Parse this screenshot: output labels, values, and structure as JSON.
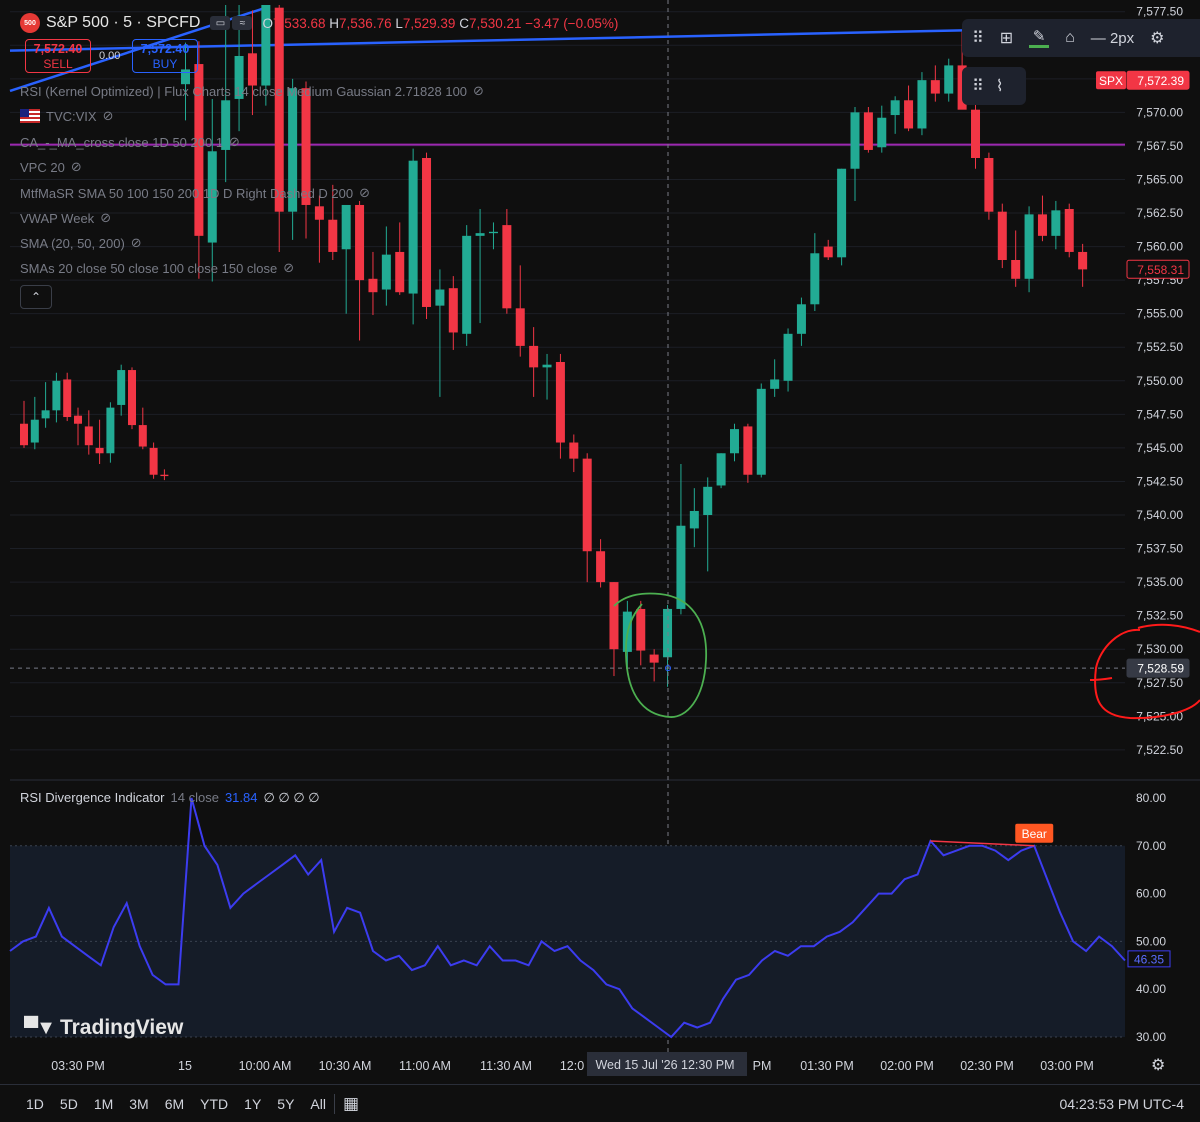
{
  "header": {
    "exchange_badge": "500",
    "symbol": "S&P 500 · 5 · SPCFD",
    "open_label": "O",
    "open": "7,533.68",
    "high_label": "H",
    "high": "7,536.76",
    "low_label": "L",
    "low": "7,529.39",
    "close_label": "C",
    "close": "7,530.21",
    "change": "−3.47 (−0.05%)"
  },
  "trade": {
    "sell_price": "7,572.40",
    "sell_label": "SELL",
    "spread": "0.00",
    "buy_price": "7,572.40",
    "buy_label": "BUY"
  },
  "indicators": [
    "RSI (Kernel Optimized) | Flux Charts 14 close Medium Gaussian 2.71828 100",
    "TVC:VIX",
    "CA_-_MA_cross close 1D 50 200 1",
    "VPC 20",
    "MtfMaSR SMA 50 100 150 200 1D D Right Dashed D 200",
    "VWAP Week",
    "SMA (20, 50, 200)",
    "SMAs 20 close 50 close 100 close 150 close"
  ],
  "toolbar": {
    "width_label": "2px"
  },
  "colors": {
    "up": "#22ab94",
    "down": "#f23645",
    "trendline": "#2962ff",
    "sr_line": "#9c27b0",
    "rsi_line": "#3c3cf0",
    "annotation_green": "#4caf50",
    "annotation_red": "#ff1a1a"
  },
  "chart_data": [
    {
      "type": "candlestick",
      "title": "S&P 500 · 5 · SPCFD",
      "price_axis": {
        "ylim": [
          7521.0,
          7578.0
        ],
        "ticks": [
          "7,577.50",
          "7,575.00",
          "7,572.50",
          "7,570.00",
          "7,567.50",
          "7,565.00",
          "7,562.50",
          "7,560.00",
          "7,557.50",
          "7,555.00",
          "7,552.50",
          "7,550.00",
          "7,547.50",
          "7,545.00",
          "7,542.50",
          "7,540.00",
          "7,537.50",
          "7,535.00",
          "7,532.50",
          "7,530.00",
          "7,527.50",
          "7,525.00",
          "7,522.50"
        ]
      },
      "time_axis": {
        "ticks": [
          "03:30 PM",
          "15",
          "10:00 AM",
          "10:30 AM",
          "11:00 AM",
          "11:30 AM",
          "12:0",
          "Wed 15 Jul '26   12:30 PM",
          "PM",
          "01:30 PM",
          "02:00 PM",
          "02:30 PM",
          "03:00 PM"
        ]
      },
      "price_labels": [
        {
          "tag": "SPX",
          "value": "7,572.39"
        },
        {
          "value": "7,558.31"
        },
        {
          "value": "7,528.59"
        }
      ],
      "previous_session_candles": [
        {
          "o": 7546.8,
          "h": 7548.5,
          "l": 7545.0,
          "c": 7545.2
        },
        {
          "o": 7545.4,
          "h": 7548.8,
          "l": 7544.9,
          "c": 7547.1
        },
        {
          "o": 7547.2,
          "h": 7549.9,
          "l": 7546.5,
          "c": 7547.8
        },
        {
          "o": 7547.8,
          "h": 7550.6,
          "l": 7546.9,
          "c": 7550.0
        },
        {
          "o": 7550.1,
          "h": 7550.6,
          "l": 7547.0,
          "c": 7547.3
        },
        {
          "o": 7547.4,
          "h": 7548.0,
          "l": 7545.2,
          "c": 7546.8
        },
        {
          "o": 7546.6,
          "h": 7547.8,
          "l": 7544.5,
          "c": 7545.2
        },
        {
          "o": 7545.0,
          "h": 7547.1,
          "l": 7543.8,
          "c": 7544.6
        },
        {
          "o": 7544.6,
          "h": 7548.4,
          "l": 7543.9,
          "c": 7548.0
        },
        {
          "o": 7548.2,
          "h": 7551.2,
          "l": 7547.4,
          "c": 7550.8
        },
        {
          "o": 7550.8,
          "h": 7551.0,
          "l": 7546.4,
          "c": 7546.7
        },
        {
          "o": 7546.7,
          "h": 7548.0,
          "l": 7544.9,
          "c": 7545.1
        },
        {
          "o": 7545.0,
          "h": 7545.4,
          "l": 7542.7,
          "c": 7543.0
        },
        {
          "o": 7543.0,
          "h": 7543.4,
          "l": 7542.6,
          "c": 7542.9
        }
      ],
      "candles": [
        {
          "o": 7572.1,
          "h": 7575.2,
          "l": 7569.4,
          "c": 7573.2
        },
        {
          "o": 7573.6,
          "h": 7575.3,
          "l": 7557.6,
          "c": 7560.8
        },
        {
          "o": 7560.3,
          "h": 7571.0,
          "l": 7557.4,
          "c": 7567.1
        },
        {
          "o": 7567.2,
          "h": 7578.0,
          "l": 7564.8,
          "c": 7570.9
        },
        {
          "o": 7571.0,
          "h": 7578.0,
          "l": 7568.6,
          "c": 7574.2
        },
        {
          "o": 7574.4,
          "h": 7577.6,
          "l": 7569.8,
          "c": 7572.0
        },
        {
          "o": 7572.0,
          "h": 7578.0,
          "l": 7570.5,
          "c": 7578.0
        },
        {
          "o": 7577.8,
          "h": 7578.0,
          "l": 7559.6,
          "c": 7562.6
        },
        {
          "o": 7562.6,
          "h": 7572.5,
          "l": 7560.5,
          "c": 7571.8
        },
        {
          "o": 7571.8,
          "h": 7572.3,
          "l": 7560.6,
          "c": 7563.1
        },
        {
          "o": 7563.0,
          "h": 7563.8,
          "l": 7558.8,
          "c": 7562.0
        },
        {
          "o": 7562.0,
          "h": 7564.6,
          "l": 7559.0,
          "c": 7559.6
        },
        {
          "o": 7559.8,
          "h": 7563.0,
          "l": 7555.0,
          "c": 7563.1
        },
        {
          "o": 7563.1,
          "h": 7563.4,
          "l": 7553.0,
          "c": 7557.5
        },
        {
          "o": 7557.6,
          "h": 7559.6,
          "l": 7554.9,
          "c": 7556.6
        },
        {
          "o": 7556.8,
          "h": 7561.5,
          "l": 7555.6,
          "c": 7559.4
        },
        {
          "o": 7559.6,
          "h": 7561.8,
          "l": 7556.4,
          "c": 7556.6
        },
        {
          "o": 7556.5,
          "h": 7567.3,
          "l": 7554.2,
          "c": 7566.4
        },
        {
          "o": 7566.6,
          "h": 7567.0,
          "l": 7554.6,
          "c": 7555.5
        },
        {
          "o": 7555.6,
          "h": 7558.3,
          "l": 7548.8,
          "c": 7556.8
        },
        {
          "o": 7556.9,
          "h": 7557.8,
          "l": 7552.3,
          "c": 7553.6
        },
        {
          "o": 7553.5,
          "h": 7561.6,
          "l": 7552.6,
          "c": 7560.8
        },
        {
          "o": 7560.8,
          "h": 7562.8,
          "l": 7554.3,
          "c": 7561.0
        },
        {
          "o": 7561.0,
          "h": 7561.8,
          "l": 7559.8,
          "c": 7561.1
        },
        {
          "o": 7561.6,
          "h": 7562.8,
          "l": 7555.0,
          "c": 7555.4
        },
        {
          "o": 7555.4,
          "h": 7558.6,
          "l": 7551.8,
          "c": 7552.6
        },
        {
          "o": 7552.6,
          "h": 7554.0,
          "l": 7548.8,
          "c": 7551.0
        },
        {
          "o": 7551.0,
          "h": 7552.0,
          "l": 7548.6,
          "c": 7551.2
        },
        {
          "o": 7551.4,
          "h": 7552.0,
          "l": 7544.2,
          "c": 7545.4
        },
        {
          "o": 7545.4,
          "h": 7546.0,
          "l": 7543.2,
          "c": 7544.2
        },
        {
          "o": 7544.2,
          "h": 7544.6,
          "l": 7535.0,
          "c": 7537.3
        },
        {
          "o": 7537.3,
          "h": 7538.2,
          "l": 7534.6,
          "c": 7535.0
        },
        {
          "o": 7535.0,
          "h": 7535.0,
          "l": 7528.0,
          "c": 7530.0
        },
        {
          "o": 7529.8,
          "h": 7533.6,
          "l": 7528.5,
          "c": 7532.8
        },
        {
          "o": 7533.0,
          "h": 7533.6,
          "l": 7528.8,
          "c": 7529.9
        },
        {
          "o": 7529.6,
          "h": 7530.0,
          "l": 7527.6,
          "c": 7529.0
        },
        {
          "o": 7529.4,
          "h": 7533.3,
          "l": 7527.2,
          "c": 7533.0
        },
        {
          "o": 7533.0,
          "h": 7543.8,
          "l": 7532.6,
          "c": 7539.2
        },
        {
          "o": 7539.0,
          "h": 7542.0,
          "l": 7537.6,
          "c": 7540.3
        },
        {
          "o": 7540.0,
          "h": 7542.8,
          "l": 7535.8,
          "c": 7542.1
        },
        {
          "o": 7542.2,
          "h": 7544.6,
          "l": 7542.0,
          "c": 7544.6
        },
        {
          "o": 7544.6,
          "h": 7546.8,
          "l": 7544.0,
          "c": 7546.4
        },
        {
          "o": 7546.6,
          "h": 7546.8,
          "l": 7542.4,
          "c": 7543.0
        },
        {
          "o": 7543.0,
          "h": 7549.8,
          "l": 7542.8,
          "c": 7549.4
        },
        {
          "o": 7549.4,
          "h": 7551.6,
          "l": 7548.8,
          "c": 7550.1
        },
        {
          "o": 7550.0,
          "h": 7553.9,
          "l": 7549.2,
          "c": 7553.5
        },
        {
          "o": 7553.5,
          "h": 7556.2,
          "l": 7552.6,
          "c": 7555.7
        },
        {
          "o": 7555.7,
          "h": 7561.0,
          "l": 7555.2,
          "c": 7559.5
        },
        {
          "o": 7560.0,
          "h": 7560.5,
          "l": 7559.0,
          "c": 7559.2
        },
        {
          "o": 7559.2,
          "h": 7565.8,
          "l": 7558.6,
          "c": 7565.8
        },
        {
          "o": 7565.8,
          "h": 7570.4,
          "l": 7563.4,
          "c": 7570.0
        },
        {
          "o": 7570.0,
          "h": 7570.4,
          "l": 7567.0,
          "c": 7567.2
        },
        {
          "o": 7567.4,
          "h": 7570.5,
          "l": 7567.0,
          "c": 7569.6
        },
        {
          "o": 7569.8,
          "h": 7571.2,
          "l": 7568.4,
          "c": 7570.9
        },
        {
          "o": 7570.9,
          "h": 7572.0,
          "l": 7568.6,
          "c": 7568.8
        },
        {
          "o": 7568.8,
          "h": 7573.0,
          "l": 7568.3,
          "c": 7572.4
        },
        {
          "o": 7572.4,
          "h": 7573.5,
          "l": 7570.8,
          "c": 7571.4
        },
        {
          "o": 7571.4,
          "h": 7574.0,
          "l": 7570.8,
          "c": 7573.5
        },
        {
          "o": 7573.5,
          "h": 7576.0,
          "l": 7571.6,
          "c": 7570.2
        },
        {
          "o": 7570.2,
          "h": 7570.6,
          "l": 7565.8,
          "c": 7566.6
        },
        {
          "o": 7566.6,
          "h": 7567.0,
          "l": 7562.0,
          "c": 7562.6
        },
        {
          "o": 7562.6,
          "h": 7563.2,
          "l": 7558.4,
          "c": 7559.0
        },
        {
          "o": 7559.0,
          "h": 7561.2,
          "l": 7557.0,
          "c": 7557.6
        },
        {
          "o": 7557.6,
          "h": 7563.0,
          "l": 7556.6,
          "c": 7562.4
        },
        {
          "o": 7562.4,
          "h": 7563.8,
          "l": 7560.4,
          "c": 7560.8
        },
        {
          "o": 7560.8,
          "h": 7563.4,
          "l": 7559.8,
          "c": 7562.7
        },
        {
          "o": 7562.8,
          "h": 7563.2,
          "l": 7559.2,
          "c": 7559.6
        },
        {
          "o": 7559.6,
          "h": 7560.2,
          "l": 7557.0,
          "c": 7558.3
        }
      ],
      "horizontal_lines": [
        {
          "name": "sr_line",
          "price": 7567.6
        }
      ],
      "trendlines": [
        {
          "name": "rising_trendline",
          "from_candle": -14,
          "from_price": 7571.6,
          "to_candle": 6,
          "to_price": 7577.8
        },
        {
          "name": "blue_horizontal",
          "from_candle": -14,
          "from_price": 7574.6,
          "to_candle": 67,
          "to_price": 7576.3
        }
      ]
    },
    {
      "type": "line",
      "title": "RSI Divergence Indicator",
      "series": [
        {
          "name": "RSI",
          "values": [
            48,
            50,
            51,
            57,
            51,
            49,
            47,
            45,
            53,
            58,
            49,
            43,
            41,
            41,
            80,
            70,
            66,
            57,
            60,
            62,
            64,
            66,
            68,
            64,
            67,
            52,
            57,
            56,
            48,
            46,
            47,
            44,
            45,
            49,
            45,
            46,
            45,
            49,
            46,
            46,
            45,
            50,
            48,
            49,
            46,
            44,
            41,
            40,
            36,
            34,
            32,
            30,
            33,
            32,
            33,
            38,
            42,
            43,
            46,
            48,
            47,
            49,
            49,
            51,
            52,
            54,
            57,
            60,
            60,
            63,
            64,
            71,
            68,
            69,
            70,
            70,
            69,
            67,
            69,
            70,
            63,
            56,
            50,
            48,
            51,
            49,
            46
          ]
        }
      ],
      "ylim": [
        27.5,
        82.5
      ],
      "ticks": [
        "80.00",
        "70.00",
        "60.00",
        "50.00",
        "40.00",
        "30.00"
      ],
      "last_value": "46.35",
      "signal_label": "Bear",
      "divergence": {
        "from_index": 71,
        "to_index": 79
      }
    }
  ],
  "rsi_legend": {
    "name": "RSI Divergence Indicator",
    "params": "14 close",
    "value": "31.84",
    "flags": "∅ ∅ ∅ ∅"
  },
  "timeframes": [
    "1D",
    "5D",
    "1M",
    "3M",
    "6M",
    "YTD",
    "1Y",
    "5Y",
    "All"
  ],
  "clock": "04:23:53 PM UTC-4",
  "watermark": "TradingView"
}
